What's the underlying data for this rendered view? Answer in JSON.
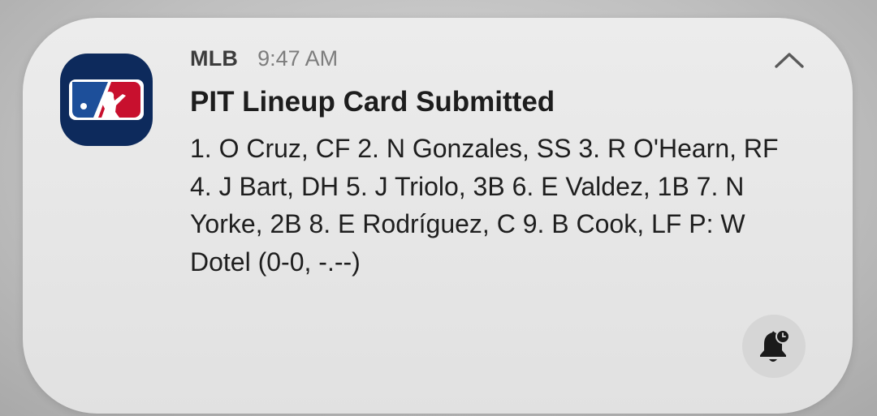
{
  "notification": {
    "app_name": "MLB",
    "time": "9:47 AM",
    "title": "PIT Lineup Card Submitted",
    "body": "1. O Cruz, CF 2. N Gonzales, SS 3. R O'Hearn, RF 4. J Bart, DH 5. J Triolo, 3B 6. E Valdez, 1B 7. N Yorke, 2B 8. E Rodríguez, C 9. B Cook, LF P: W Dotel (0-0, -.--)",
    "app_icon": "mlb-logo-icon",
    "collapse_icon": "chevron-up-icon",
    "action_icon": "bell-snooze-icon"
  },
  "colors": {
    "icon_background": "#0d2a5c",
    "logo_red": "#c8102e",
    "logo_blue": "#1d4f9a",
    "card_background": "#e8e8e8",
    "action_button_background": "#d6d6d6"
  }
}
